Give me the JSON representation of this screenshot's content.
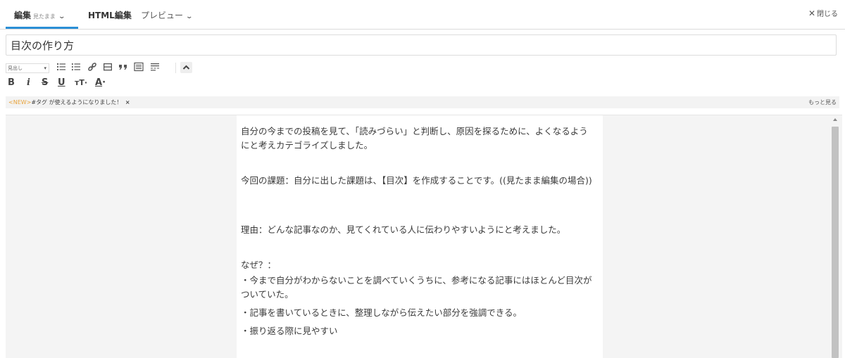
{
  "tabs": {
    "edit_label": "編集",
    "edit_sub": "見たまま",
    "html_label": "HTML編集",
    "preview_label": "プレビュー",
    "close_label": "閉じる"
  },
  "title": {
    "value": "目次の作り方"
  },
  "toolbar": {
    "heading_select": "見出し",
    "icons": [
      "bulleted-list-icon",
      "numbered-list-icon",
      "link-icon",
      "horizontal-rule-icon",
      "blockquote-icon",
      "table-of-contents-icon",
      "more-icon",
      "collapse-toolbar-icon"
    ],
    "format": {
      "bold": "B",
      "italic": "i",
      "strike": "S",
      "underline": "U",
      "size": "тT",
      "color": "A"
    }
  },
  "notice": {
    "tag": "<NEW>",
    "text": "#タグ が使えるようになりました！",
    "dismiss": "×",
    "more": "もっと見る"
  },
  "content": {
    "paragraphs": [
      "自分の今までの投稿を見て、「読みづらい」と判断し、原因を探るために、よくなるようにと考えカテゴライズしました。",
      "今回の課題：自分に出した課題は、【目次】を作成することです。((見たまま編集の場合))",
      "理由：どんな記事なのか、見てくれている人に伝わりやすいようにと考えました。",
      "なぜ？：",
      "・今まで自分がわからないことを調べていくうちに、参考になる記事にはほとんど目次がついていた。",
      "・記事を書いているときに、整理しながら伝えたい部分を強調できる。",
      "・振り返る際に見やすい"
    ]
  },
  "colors": {
    "accent": "#2a8fd6",
    "new_tag": "#e8a33b"
  }
}
